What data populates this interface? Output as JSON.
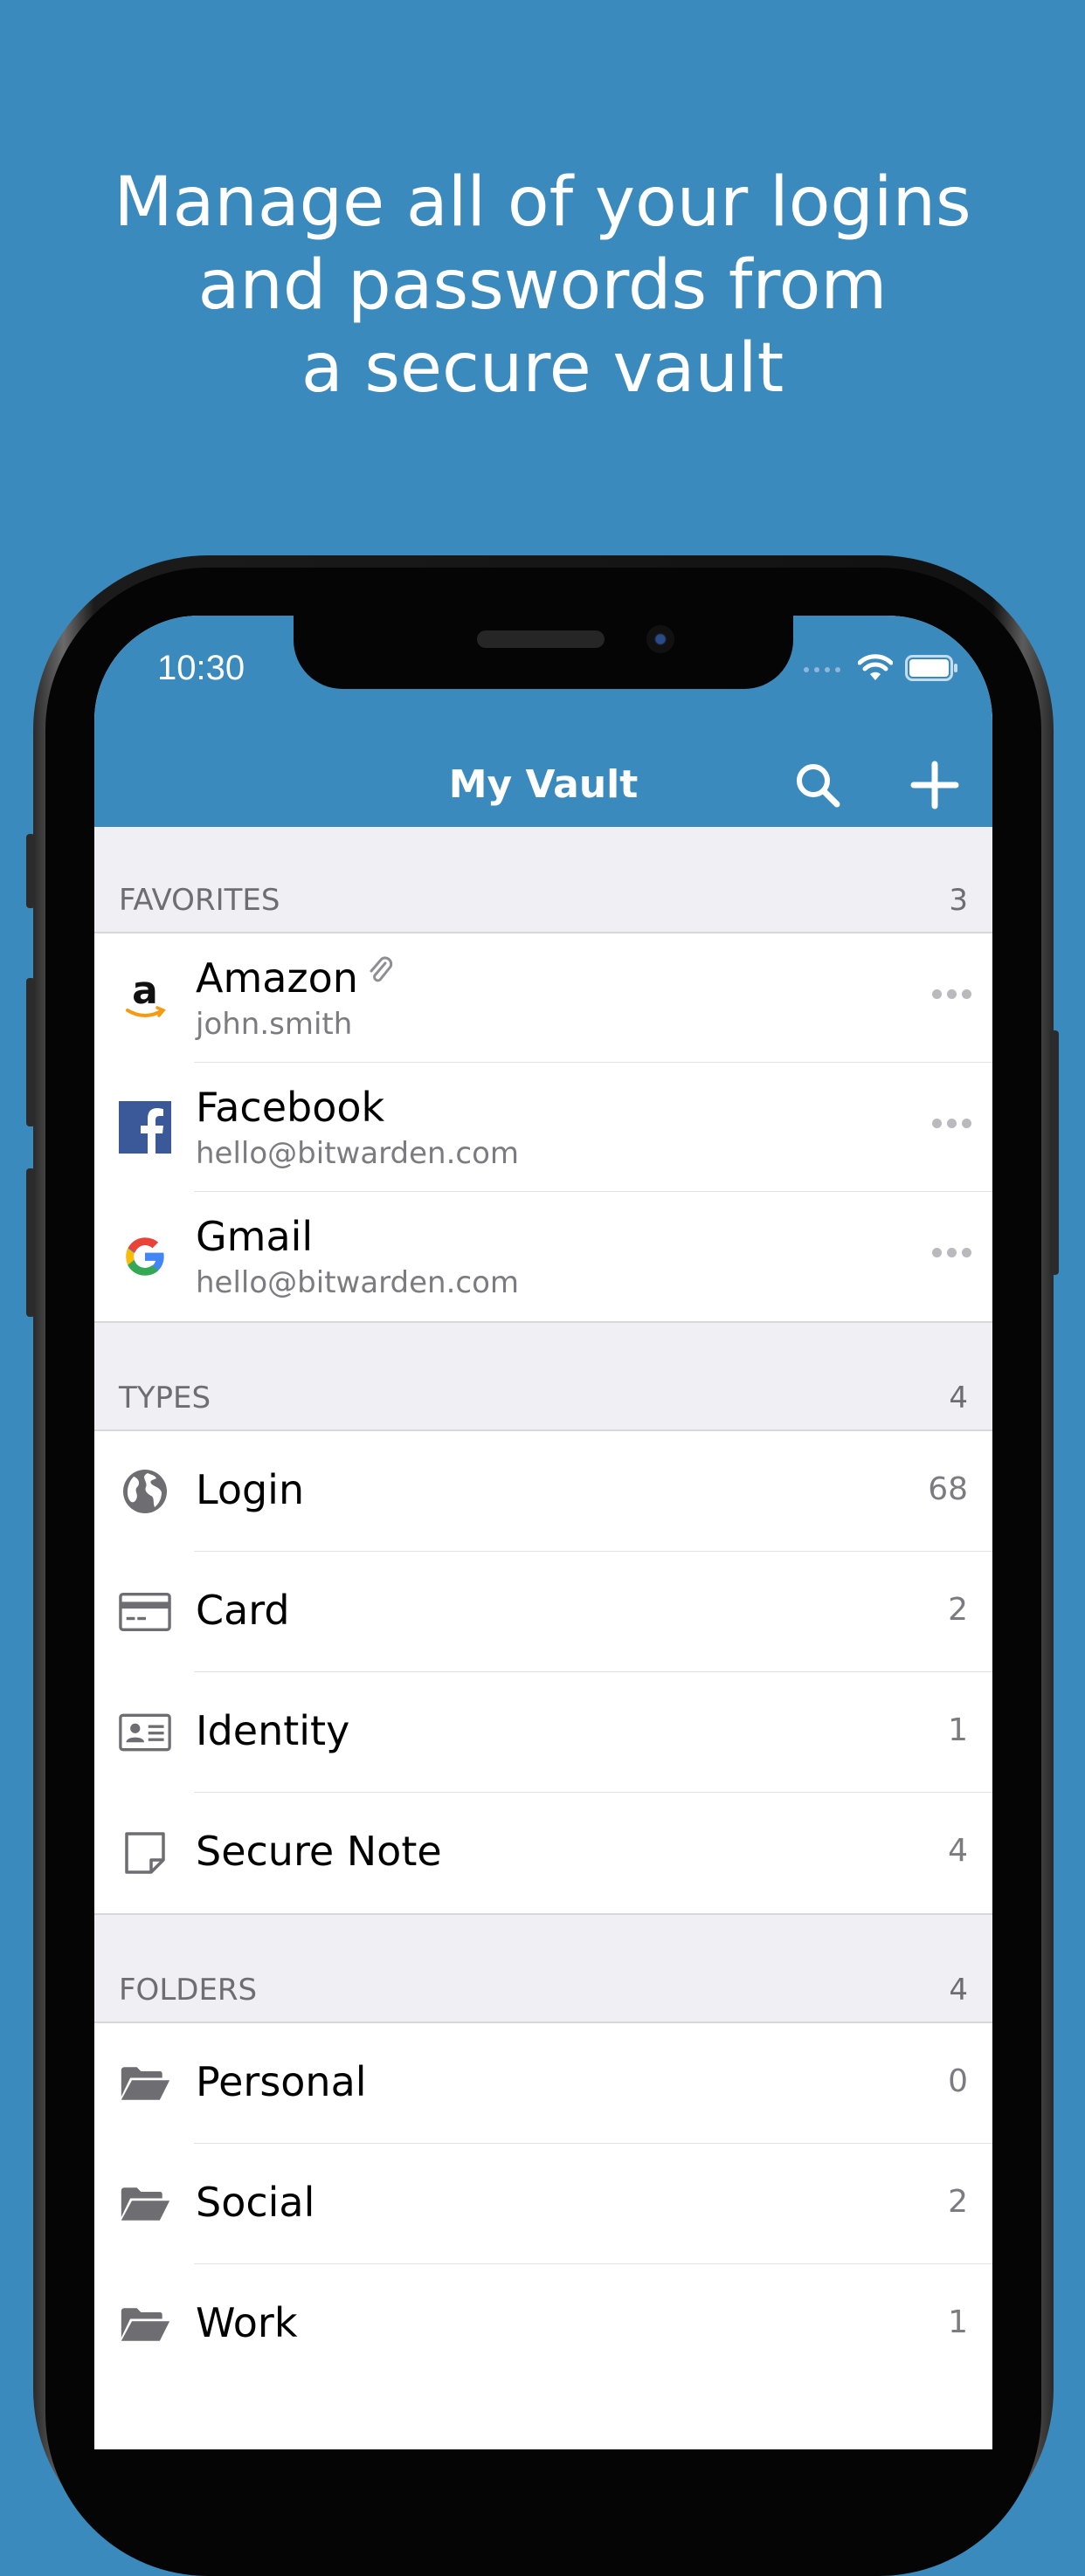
{
  "headline": {
    "line1": "Manage all of your logins",
    "line2": "and passwords from",
    "line3": "a secure vault"
  },
  "status_bar": {
    "time": "10:30"
  },
  "navbar": {
    "title": "My Vault"
  },
  "sections": {
    "favorites": {
      "label": "FAVORITES",
      "count": "3",
      "items": [
        {
          "title": "Amazon",
          "subtitle": "john.smith",
          "icon": "amazon-logo",
          "has_attachment": true
        },
        {
          "title": "Facebook",
          "subtitle": "hello@bitwarden.com",
          "icon": "facebook-logo"
        },
        {
          "title": "Gmail",
          "subtitle": "hello@bitwarden.com",
          "icon": "google-logo"
        }
      ]
    },
    "types": {
      "label": "TYPES",
      "count": "4",
      "items": [
        {
          "title": "Login",
          "count": "68",
          "icon": "globe-icon"
        },
        {
          "title": "Card",
          "count": "2",
          "icon": "credit-card-icon"
        },
        {
          "title": "Identity",
          "count": "1",
          "icon": "id-card-icon"
        },
        {
          "title": "Secure Note",
          "count": "4",
          "icon": "note-icon"
        }
      ]
    },
    "folders": {
      "label": "FOLDERS",
      "count": "4",
      "items": [
        {
          "title": "Personal",
          "count": "0",
          "icon": "folder-open-icon"
        },
        {
          "title": "Social",
          "count": "2",
          "icon": "folder-open-icon"
        },
        {
          "title": "Work",
          "count": "1",
          "icon": "folder-open-icon"
        }
      ]
    }
  },
  "colors": {
    "brand": "#3b8abd",
    "section_bg": "#efeff4",
    "secondary_text": "#7b7b80"
  }
}
